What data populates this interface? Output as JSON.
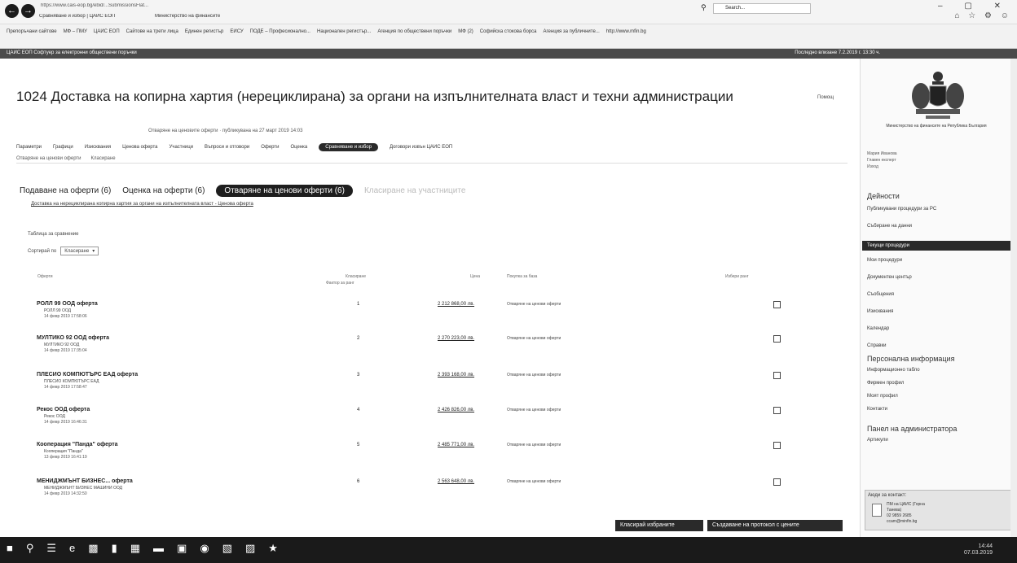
{
  "browser": {
    "url": "https://www.cais-eop.bg/ebid/...SubmissionsFlat...",
    "tab1": "Сравняване и избор | ЦАИС ЕОП",
    "tab2": "Министерство на финансите",
    "search_placeholder": "Search...",
    "favorites": [
      "Препоръчани сайтове",
      "МФ – ПМУ",
      "ЦАИС ЕОП",
      "Сайтове на трети лица",
      "Единен регистър",
      "ЕИСУ",
      "ПОДЕ – Професионално...",
      "Национален регистър...",
      "Агенция по обществени поръчки",
      "МФ (2)",
      "Софийска стокова борса",
      "Агенция за публичните...",
      "http://www.mfin.bg"
    ]
  },
  "site_bar": {
    "left": "ЦАИС ЕОП Софтуер за електронни обществени поръчки",
    "right": "Последно влизане 7.2.2019 г. 13:30 ч."
  },
  "header": {
    "title": "1024 Доставка на копирна хартия (нерециклирана) за органи на изпълнителната власт и техни администрации",
    "subtitle": "Отваряне на ценовите оферти · публикувана на 27 март 2019 14:03",
    "help": "Помощ"
  },
  "main_tabs": [
    "Параметри",
    "Графици",
    "Изисквания",
    "Ценова оферта",
    "Участници",
    "Въпроси и отговори",
    "Оферти",
    "Оценка",
    "Сравняване и избор",
    "Договори извън ЦАИС ЕОП"
  ],
  "active_main_tab": "Сравняване и избор",
  "sub_tabs": [
    "Отваряне на ценови оферти",
    "Класиране"
  ],
  "stage_tabs": [
    {
      "label": "Подаване на оферти (6)",
      "state": "done"
    },
    {
      "label": "Оценка на оферти (6)",
      "state": "done"
    },
    {
      "label": "Отваряне на ценови оферти (6)",
      "state": "active"
    },
    {
      "label": "Класиране на участниците",
      "state": "inactive"
    }
  ],
  "procedure_link": "Доставка на нерециклирана копирна хартия за органи на изпълнителната власт - Ценова оферта",
  "compare_label": "Таблица за сравнение",
  "sort": {
    "label": "Сортирай по",
    "value": "Класиране"
  },
  "table": {
    "headers": [
      "Оферти",
      "Класиране",
      "Фактор за ранг",
      "Цена",
      "Покупка за база",
      "Избери ранг"
    ],
    "rows": [
      {
        "offer": "РОЛЛ 99 ООД оферта",
        "company": "РОЛЛ 99 ООД",
        "date": "14 февр 2019 17:58:06",
        "rank": "1",
        "price": "2 212 868,00 лв.",
        "basis": "Отваряне на ценови оферти"
      },
      {
        "offer": "МУЛТИКО 92 ООД оферта",
        "company": "МУЛТИКО 92 ООД",
        "date": "14 февр 2019 17:35:04",
        "rank": "2",
        "price": "2 270 223,00 лв.",
        "basis": "Отваряне на ценови оферти"
      },
      {
        "offer": "ПЛЕСИО КОМПЮТЪРС ЕАД оферта",
        "company": "ПЛЕСИО КОМПЮТЪРС ЕАД",
        "date": "14 февр 2019 17:58:47",
        "rank": "3",
        "price": "2 393 168,00 лв.",
        "basis": "Отваряне на ценови оферти"
      },
      {
        "offer": "Рекос ООД оферта",
        "company": "Рекос ООД",
        "date": "14 февр 2019 16:46:31",
        "rank": "4",
        "price": "2 426 826,00 лв.",
        "basis": "Отваряне на ценови оферти"
      },
      {
        "offer": "Кооперация \"Панда\" оферта",
        "company": "Кооперация \"Панда\"",
        "date": "13 февр 2019 16:41:19",
        "rank": "5",
        "price": "2 485 771,00 лв.",
        "basis": "Отваряне на ценови оферти"
      },
      {
        "offer": "МЕНИДЖМЪНТ БИЗНЕС... оферта",
        "company": "МЕНИДЖМЪНТ БИЗНЕС МАШИНИ ООД",
        "date": "14 февр 2019 14:32:50",
        "rank": "6",
        "price": "2 563 648,00 лв.",
        "basis": "Отваряне на ценови оферти"
      }
    ]
  },
  "buttons": {
    "rank": "Класирай избраните",
    "create": "Създаване на протокол с цените"
  },
  "sidebar": {
    "ministry": "Министерство на финансите на Република България",
    "user": [
      "Мария Иванова",
      "Главен експерт",
      "Изход"
    ],
    "activities_heading": "Дейности",
    "activities": [
      "Публикувани процедури за РС",
      "Събиране на данни",
      "Текущи процедури",
      "Мои процедури",
      "Документен център",
      "Съобщения",
      "Изисквания",
      "Календар",
      "Справки"
    ],
    "active_activity": "Текущи процедури",
    "personal_heading": "Персонална информация",
    "personal": [
      "Информационно табло",
      "Фирмен профил",
      "Моят профил",
      "Контакти"
    ],
    "admin_heading": "Панел на администратора",
    "admin": [
      "Артикули"
    ],
    "help_box": {
      "title": "Аюди за контакт:",
      "lines": [
        "ПМ на ЦАИС (Горна",
        "Танева)",
        "02 9859 2685",
        "ccam@minfin.bg"
      ]
    }
  },
  "taskbar": {
    "time": "14:44",
    "date": "07.03.2019"
  }
}
